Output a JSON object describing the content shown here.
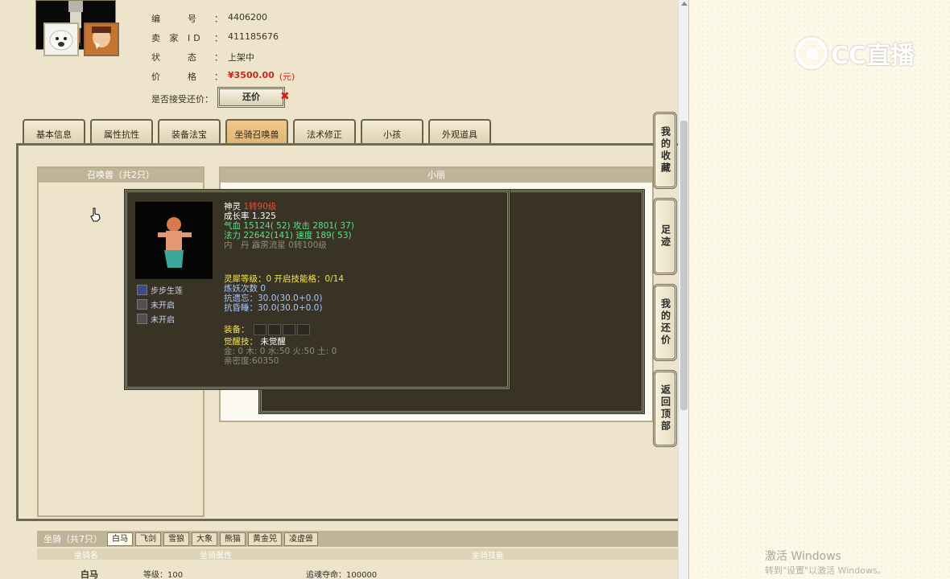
{
  "info": {
    "id_label": "编　　号",
    "id_value": "4406200",
    "seller_label": "卖 家 ID",
    "seller_value": "411185676",
    "status_label": "状　　态",
    "status_value": "上架中",
    "price_label": "价　　格",
    "price_value": "¥3500.00",
    "price_unit": "(元)",
    "offer_label": "是否接受还价：",
    "offer_button": "还价",
    "close_glyph": "✖"
  },
  "tabs": [
    "基本信息",
    "属性抗性",
    "装备法宝",
    "坐骑召唤兽",
    "法术修正",
    "小孩",
    "外观道具"
  ],
  "active_tab": 3,
  "summons": {
    "header": "召唤兽（共2只）",
    "right_header": "小丽"
  },
  "popup": {
    "name": "神灵",
    "level": "1转90级",
    "growth": "成长率 1.325",
    "hp_label": "气血",
    "hp": "15124( 52)",
    "atk_label": "攻击",
    "atk": "2801( 37)",
    "mp_label": "法力",
    "mp": "22642(141)",
    "spd_label": "速度",
    "spd": "189( 53)",
    "dan_label": "内　丹",
    "dan_value": "霹雳流星 0转100级",
    "skills": [
      "步步生莲",
      "未开启",
      "未开启"
    ],
    "lingjue": "灵犀等级：0 开启技能格：0/14",
    "lianyao": "炼妖次数 0",
    "kang_yiwang": "抗遗忘：30.0(30.0+0.0)",
    "kang_hunshui": "抗昏睡：30.0(30.0+0.0)",
    "equip_label": "装备：",
    "awaken_label": "觉醒技：",
    "awaken_value": "未觉醒",
    "elements": "金: 0 木: 0 水:50 火:50 土: 0",
    "intimacy": "亲密度:60350"
  },
  "side_buttons": [
    "我的收藏",
    "足迹",
    "我的还价",
    "返回顶部"
  ],
  "mounts": {
    "title": "坐骑（共7只）",
    "tabs": [
      "白马",
      "飞剑",
      "雪狼",
      "大象",
      "熊猫",
      "黄金兕",
      "凌虚兽"
    ],
    "active": 0,
    "col_name": "坐骑名",
    "col_attr": "坐骑属性",
    "col_skill": "坐骑技能",
    "row_name": "白马",
    "row_level": "等级：100",
    "row_soul": "追魂夺命：100000"
  },
  "watermark": {
    "logo_text": "CC直播",
    "activate": "激活 Windows",
    "activate_sub": "转到\"设置\"以激活 Windows。"
  }
}
